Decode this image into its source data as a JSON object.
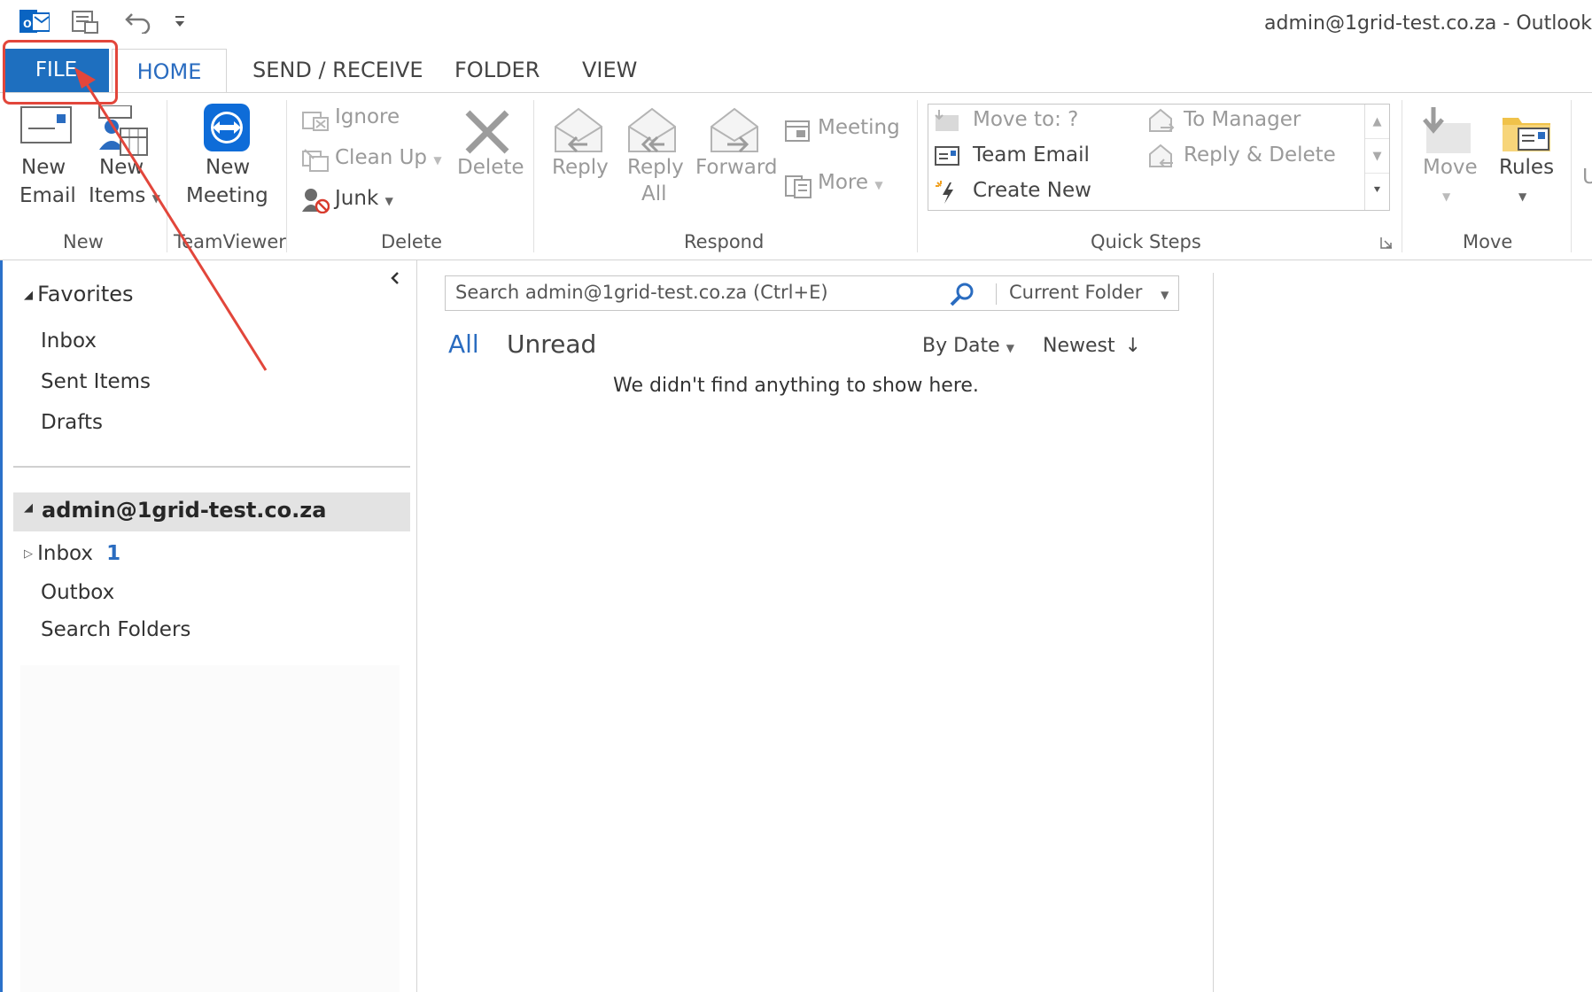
{
  "window": {
    "title": "admin@1grid-test.co.za - Outlook"
  },
  "tabs": {
    "file": "FILE",
    "home": "HOME",
    "send_receive": "SEND / RECEIVE",
    "folder": "FOLDER",
    "view": "VIEW"
  },
  "ribbon": {
    "new_group": {
      "label": "New",
      "new_email_1": "New",
      "new_email_2": "Email",
      "new_items_1": "New",
      "new_items_2": "Items"
    },
    "teamviewer_group": {
      "label": "TeamViewer",
      "new_meeting_1": "New",
      "new_meeting_2": "Meeting"
    },
    "delete_group": {
      "label": "Delete",
      "ignore": "Ignore",
      "clean_up": "Clean Up",
      "junk": "Junk",
      "delete": "Delete"
    },
    "respond_group": {
      "label": "Respond",
      "reply": "Reply",
      "reply_all_1": "Reply",
      "reply_all_2": "All",
      "forward": "Forward",
      "meeting": "Meeting",
      "more": "More"
    },
    "quick_steps_group": {
      "label": "Quick Steps",
      "move_to": "Move to: ?",
      "team_email": "Team Email",
      "create_new": "Create New",
      "to_manager": "To Manager",
      "reply_delete": "Reply & Delete"
    },
    "move_group": {
      "label": "Move",
      "move": "Move",
      "rules": "Rules"
    }
  },
  "folders": {
    "favorites_header": "Favorites",
    "favorites": [
      "Inbox",
      "Sent Items",
      "Drafts"
    ],
    "account": "admin@1grid-test.co.za",
    "inbox": "Inbox",
    "inbox_unread": "1",
    "outbox": "Outbox",
    "search_folders": "Search Folders"
  },
  "message_list": {
    "search_placeholder": "Search admin@1grid-test.co.za (Ctrl+E)",
    "scope": "Current Folder",
    "filter_all": "All",
    "filter_unread": "Unread",
    "sort_by": "By Date",
    "order": "Newest",
    "empty_message": "We didn't find anything to show here."
  },
  "colors": {
    "accent_blue": "#1e6fbf",
    "link_blue": "#2a6cc0",
    "annotation_red": "#e2463b"
  }
}
